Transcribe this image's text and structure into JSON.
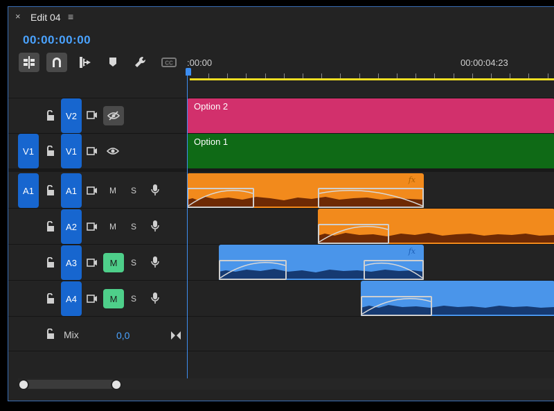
{
  "tab": {
    "close_glyph": "×",
    "title": "Edit 04",
    "menu_icon": "hamburger-menu-icon"
  },
  "timecode": "00:00:00:00",
  "tools": [
    {
      "name": "insert-nest-icon",
      "active": true
    },
    {
      "name": "snap-magnet-icon",
      "active": true
    },
    {
      "name": "linked-selection-icon",
      "active": false
    },
    {
      "name": "add-marker-icon",
      "active": false
    },
    {
      "name": "wrench-settings-icon",
      "active": false
    },
    {
      "name": "captions-cc-icon",
      "active": false
    }
  ],
  "ruler": {
    "start_label": ":00:00",
    "mid_label": "00:00:04:23"
  },
  "tracks": {
    "v2": {
      "label": "V2"
    },
    "v1": {
      "label": "V1",
      "source": "V1"
    },
    "a1": {
      "label": "A1",
      "source": "A1",
      "mute": "M",
      "solo": "S"
    },
    "a2": {
      "label": "A2",
      "mute": "M",
      "solo": "S"
    },
    "a3": {
      "label": "A3",
      "mute": "M",
      "solo": "S",
      "mute_active": true
    },
    "a4": {
      "label": "A4",
      "mute": "M",
      "solo": "S",
      "mute_active": true
    },
    "mix": {
      "label": "Mix",
      "value": "0,0"
    }
  },
  "clips": {
    "v2": {
      "name": "Option 2",
      "color": "#d2306c"
    },
    "v1": {
      "name": "Option 1",
      "color": "#0f6a16"
    },
    "a1": {
      "color": "#f28a1c",
      "fx": "fx"
    },
    "a2": {
      "color": "#f28a1c"
    },
    "a3": {
      "color": "#4a95ea",
      "fx": "fx"
    },
    "a4": {
      "color": "#4a95ea"
    }
  },
  "colors": {
    "accent": "#1766cf",
    "timecode": "#4aa3ff",
    "work_area": "#f2df22",
    "mute_on": "#4ecf8a"
  }
}
